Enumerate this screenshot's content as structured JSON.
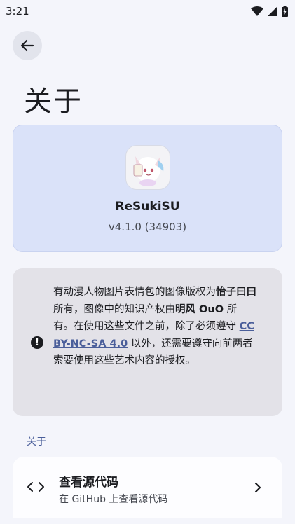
{
  "status_bar": {
    "time": "3:21",
    "icons": [
      "wifi-icon",
      "signal-icon",
      "battery-icon"
    ]
  },
  "header": {
    "back_icon": "arrow-left-icon",
    "title": "关于"
  },
  "app_card": {
    "name": "ReSukiSU",
    "version": "v4.1.0 (34903)",
    "icon": "app-logo-icon"
  },
  "notice": {
    "icon": "exclamation-circle-icon",
    "part1": "有动漫人物图片表情包的图像版权为",
    "author1": "怡子曰曰",
    "part2": "所有，图像中的知识产权由",
    "author2": "明风 OuO",
    "part3": " 所有。在使用这些文件之前，除了必须遵守 ",
    "license": "CC BY-NC-SA 4.0",
    "part4": " 以外，还需要遵守向前两者索要使用这些艺术内容的授权。"
  },
  "section": {
    "label": "关于"
  },
  "source_item": {
    "icon": "code-icon",
    "title": "查看源代码",
    "subtitle": "在 GitHub 上查看源代码",
    "chevron": "chevron-right-icon"
  },
  "colors": {
    "background": "#f4f5fb",
    "app_card": "#dae2f9",
    "notice_card": "#e3e2e8",
    "accent": "#4a5e9a"
  }
}
